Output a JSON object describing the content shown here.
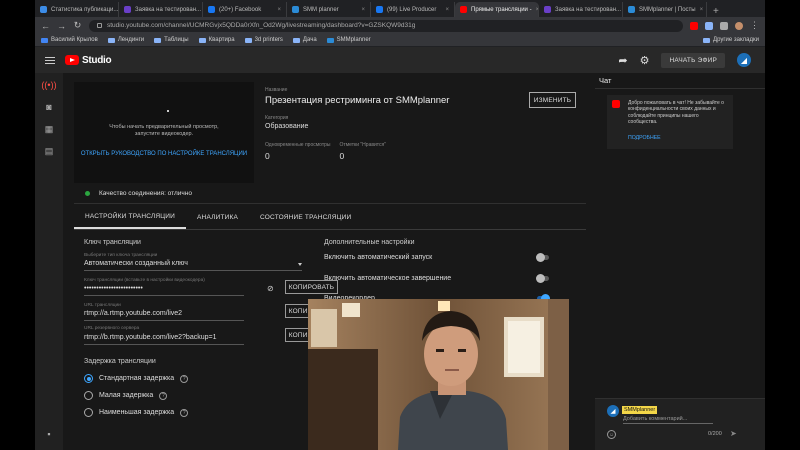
{
  "browser": {
    "tabs": [
      {
        "title": "Статистика публикаци...",
        "active": false,
        "color": "#3c8ce7"
      },
      {
        "title": "Заявка на тестирован...",
        "active": false,
        "color": "#6a3fc8"
      },
      {
        "title": "(20+) Facebook",
        "active": false,
        "color": "#1877f2"
      },
      {
        "title": "SMM planner",
        "active": false,
        "color": "#2b8bd6"
      },
      {
        "title": "(99) Live Producer",
        "active": false,
        "color": "#1877f2"
      },
      {
        "title": "Прямые трансляции -",
        "active": true,
        "color": "#ff0000"
      },
      {
        "title": "Заявка на тестирован...",
        "active": false,
        "color": "#6a3fc8"
      },
      {
        "title": "SMMplanner | Посты",
        "active": false,
        "color": "#2b8bd6"
      }
    ],
    "url": "studio.youtube.com/channel/UCMRGvjx5QDDa0rXfn_Od2Wg/livestreaming/dashboard?v=GZSKQW9d31g",
    "bookmarks": [
      "Василий Крылов",
      "Лендинги",
      "Таблицы",
      "Квартира",
      "3d printers",
      "Дача",
      "SMMplanner"
    ],
    "other_bookmarks": "Другие закладки"
  },
  "studio": {
    "logo_text": "Studio",
    "go_live": "НАЧАТЬ ЭФИР"
  },
  "preview": {
    "message": "Чтобы начать предварительный просмотр, запустите видеокодер.",
    "setup_link": "ОТКРЫТЬ РУКОВОДСТВО ПО НАСТРОЙКЕ ТРАНСЛЯЦИИ"
  },
  "stream": {
    "title_caption": "Название",
    "title": "Презентация рестриминга от SMMplanner",
    "category_caption": "Категория",
    "category": "Образование",
    "viewers_caption": "Одновременные просмотры",
    "viewers": "0",
    "likes_caption": "Отметки \"Нравится\"",
    "likes": "0",
    "edit_button": "ИЗМЕНИТЬ"
  },
  "connection": "Качество соединения: отлично",
  "tabs": [
    "НАСТРОЙКИ ТРАНСЛЯЦИИ",
    "АНАЛИТИКА",
    "СОСТОЯНИЕ ТРАНСЛЯЦИИ"
  ],
  "settings": {
    "key_title": "Ключ трансляции",
    "key_type_caption": "Выберите тип ключа трансляции",
    "key_type": "Автоматически созданный ключ",
    "key_caption": "Ключ трансляции (вставьте в настройки видеокодера)",
    "key_value": "••••••••••••••••••••••••",
    "copy_label": "КОПИРОВАТЬ",
    "url_caption": "URL трансляции",
    "url_value": "rtmp://a.rtmp.youtube.com/live2",
    "backup_caption": "URL резервного сервера",
    "backup_value": "rtmp://b.rtmp.youtube.com/live2?backup=1",
    "latency_title": "Задержка трансляции",
    "latency_options": [
      "Стандартная задержка",
      "Малая задержка",
      "Наименьшая задержка"
    ],
    "latency_selected": 0,
    "extra_title": "Дополнительные настройки",
    "toggles": [
      {
        "label": "Включить автоматический запуск",
        "on": false
      },
      {
        "label": "Включить автоматическое завершение",
        "on": false
      },
      {
        "label": "Видеорекордер",
        "on": true
      }
    ]
  },
  "chat": {
    "title": "Чат",
    "notice": "Добро пожаловать в чат! Не забывайте о конфиденциальности своих данных и соблюдайте принципы нашего сообщества.",
    "notice_link": "ПОДРОБНЕЕ",
    "channel": "SMMplanner",
    "placeholder": "Добавить комментарий...",
    "counter": "0/200"
  }
}
